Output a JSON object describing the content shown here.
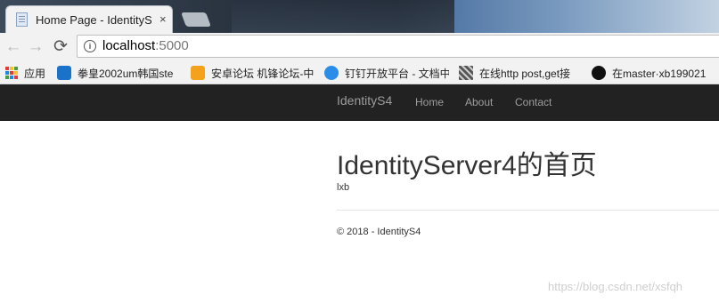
{
  "browser": {
    "tab": {
      "title": "Home Page - IdentityS",
      "close_glyph": "×"
    },
    "toolbar": {
      "back_glyph": "←",
      "forward_glyph": "→",
      "reload_glyph": "⟳",
      "info_glyph": "i",
      "url_host": "localhost",
      "url_port": ":5000"
    },
    "bookmarks": [
      {
        "label": "应用",
        "icon": "apps-grid-icon"
      },
      {
        "label": "拳皇2002um韩国ste",
        "icon": "cube-icon",
        "color": "#1a73c8"
      },
      {
        "label": "安卓论坛 机锋论坛-中",
        "icon": "gfan-icon",
        "color": "#f4a11c"
      },
      {
        "label": "钉钉开放平台 - 文档中",
        "icon": "dingtalk-icon",
        "color": "#2a8ee8"
      },
      {
        "label": "在线http post,get接",
        "icon": "qr-icon",
        "color": "#555555"
      },
      {
        "label": "在master·xb199021",
        "icon": "github-icon",
        "color": "#111111"
      }
    ]
  },
  "site": {
    "nav": {
      "brand": "IdentityS4",
      "links": [
        "Home",
        "About",
        "Contact"
      ]
    },
    "heading": "IdentityServer4的首页",
    "subtext": "lxb",
    "footer": "© 2018 - IdentityS4"
  },
  "watermark": "https://blog.csdn.net/xsfqh",
  "colors": {
    "navbar_bg": "#222222",
    "navbar_text": "#9d9d9d",
    "page_text": "#333333"
  }
}
